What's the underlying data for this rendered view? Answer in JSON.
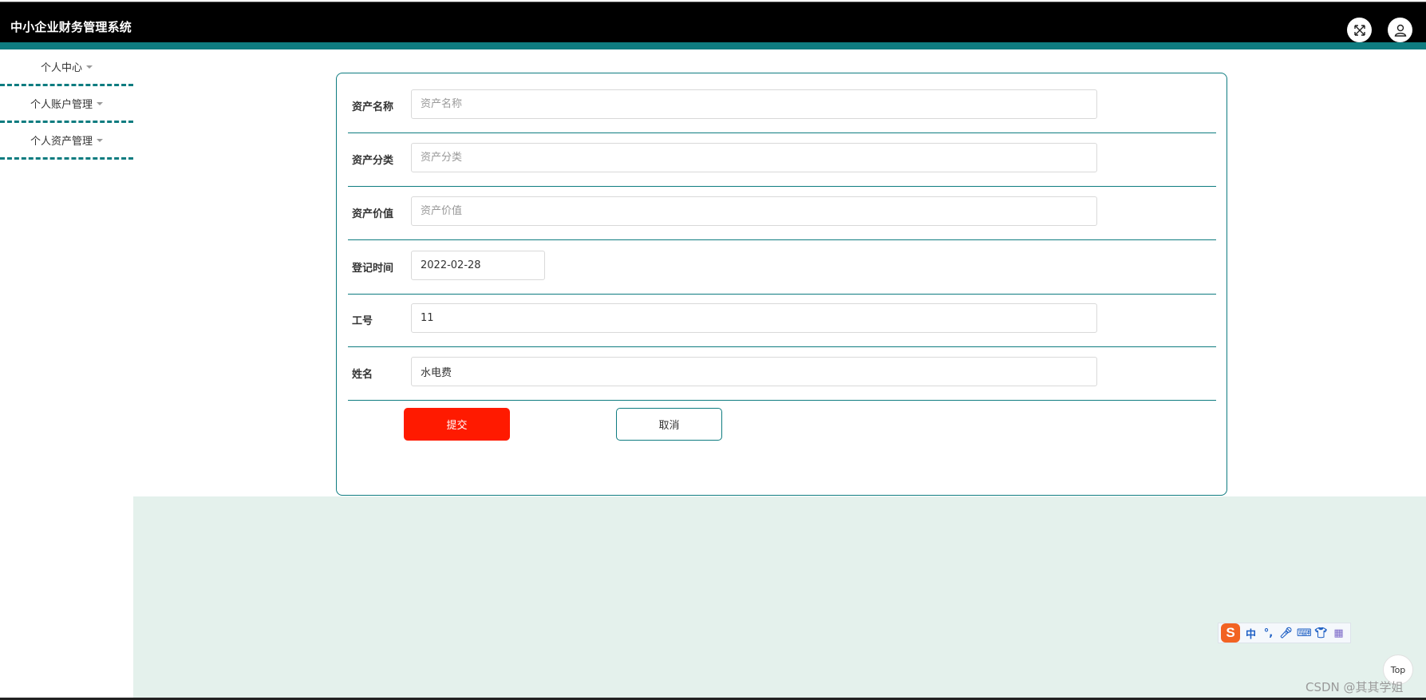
{
  "header": {
    "title": "中小企业财务管理系统",
    "fullscreen_icon": "fullscreen-icon",
    "user_icon": "user-icon",
    "bg_color": "#000000",
    "accent_color": "#0e7c80"
  },
  "sidebar": {
    "items": [
      {
        "label": "个人中心"
      },
      {
        "label": "个人账户管理"
      },
      {
        "label": "个人资产管理"
      }
    ]
  },
  "form": {
    "fields": [
      {
        "label": "资产名称",
        "value": "",
        "placeholder": "资产名称"
      },
      {
        "label": "资产分类",
        "value": "",
        "placeholder": "资产分类"
      },
      {
        "label": "资产价值",
        "value": "",
        "placeholder": "资产价值"
      },
      {
        "label": "登记时间",
        "value": "2022-02-28",
        "placeholder": ""
      },
      {
        "label": "工号",
        "value": "11",
        "placeholder": ""
      },
      {
        "label": "姓名",
        "value": "水电费",
        "placeholder": ""
      }
    ],
    "submit_label": "提交",
    "cancel_label": "取消",
    "submit_color": "#ff1a00"
  },
  "ime": {
    "logo": "S",
    "lang": "中",
    "punct": "°,",
    "icons": [
      "microphone-icon",
      "keyboard-icon",
      "shirt-icon",
      "grid-icon"
    ]
  },
  "back_to_top": "Top",
  "watermark": "CSDN @其其学姐"
}
